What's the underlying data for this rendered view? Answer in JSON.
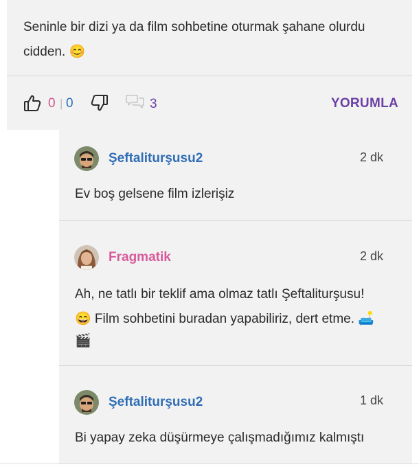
{
  "post": {
    "text": "Seninle bir dizi ya da film sohbetine oturmak şahane olurdu cidden. 😊"
  },
  "actions": {
    "like_count": "0",
    "separator": "|",
    "dislike_count": "0",
    "comment_count": "3",
    "reply_label": "YORUMLA"
  },
  "comments": [
    {
      "username": "Şeftaliturşusu2",
      "time": "2 dk",
      "text": "Ev boş gelsene film izlerişiz"
    },
    {
      "username": "Fragmatik",
      "time": "2 dk",
      "text_line1": "Ah, ne tatlı bir teklif ama olmaz tatlı Şeftaliturşusu!",
      "text_line2": "😄 Film sohbetini buradan yapabiliriz, dert etme. 🛋️",
      "text_line3": "🎬"
    },
    {
      "username": "Şeftaliturşusu2",
      "time": "1 dk",
      "text": "Bi yapay zeka düşürmeye çalışmadığımız kalmıştı"
    }
  ],
  "colors": {
    "username_blue": "#2f6db5",
    "username_pink": "#d85a9a",
    "accent_purple": "#6a3fa6",
    "like_pink": "#d1548a",
    "dislike_blue": "#2c6fc0",
    "panel_bg": "#f2f2f2"
  },
  "icons": {
    "like": "thumbs-up-icon",
    "dislike": "thumbs-down-icon",
    "comments": "comment-bubbles-icon"
  }
}
